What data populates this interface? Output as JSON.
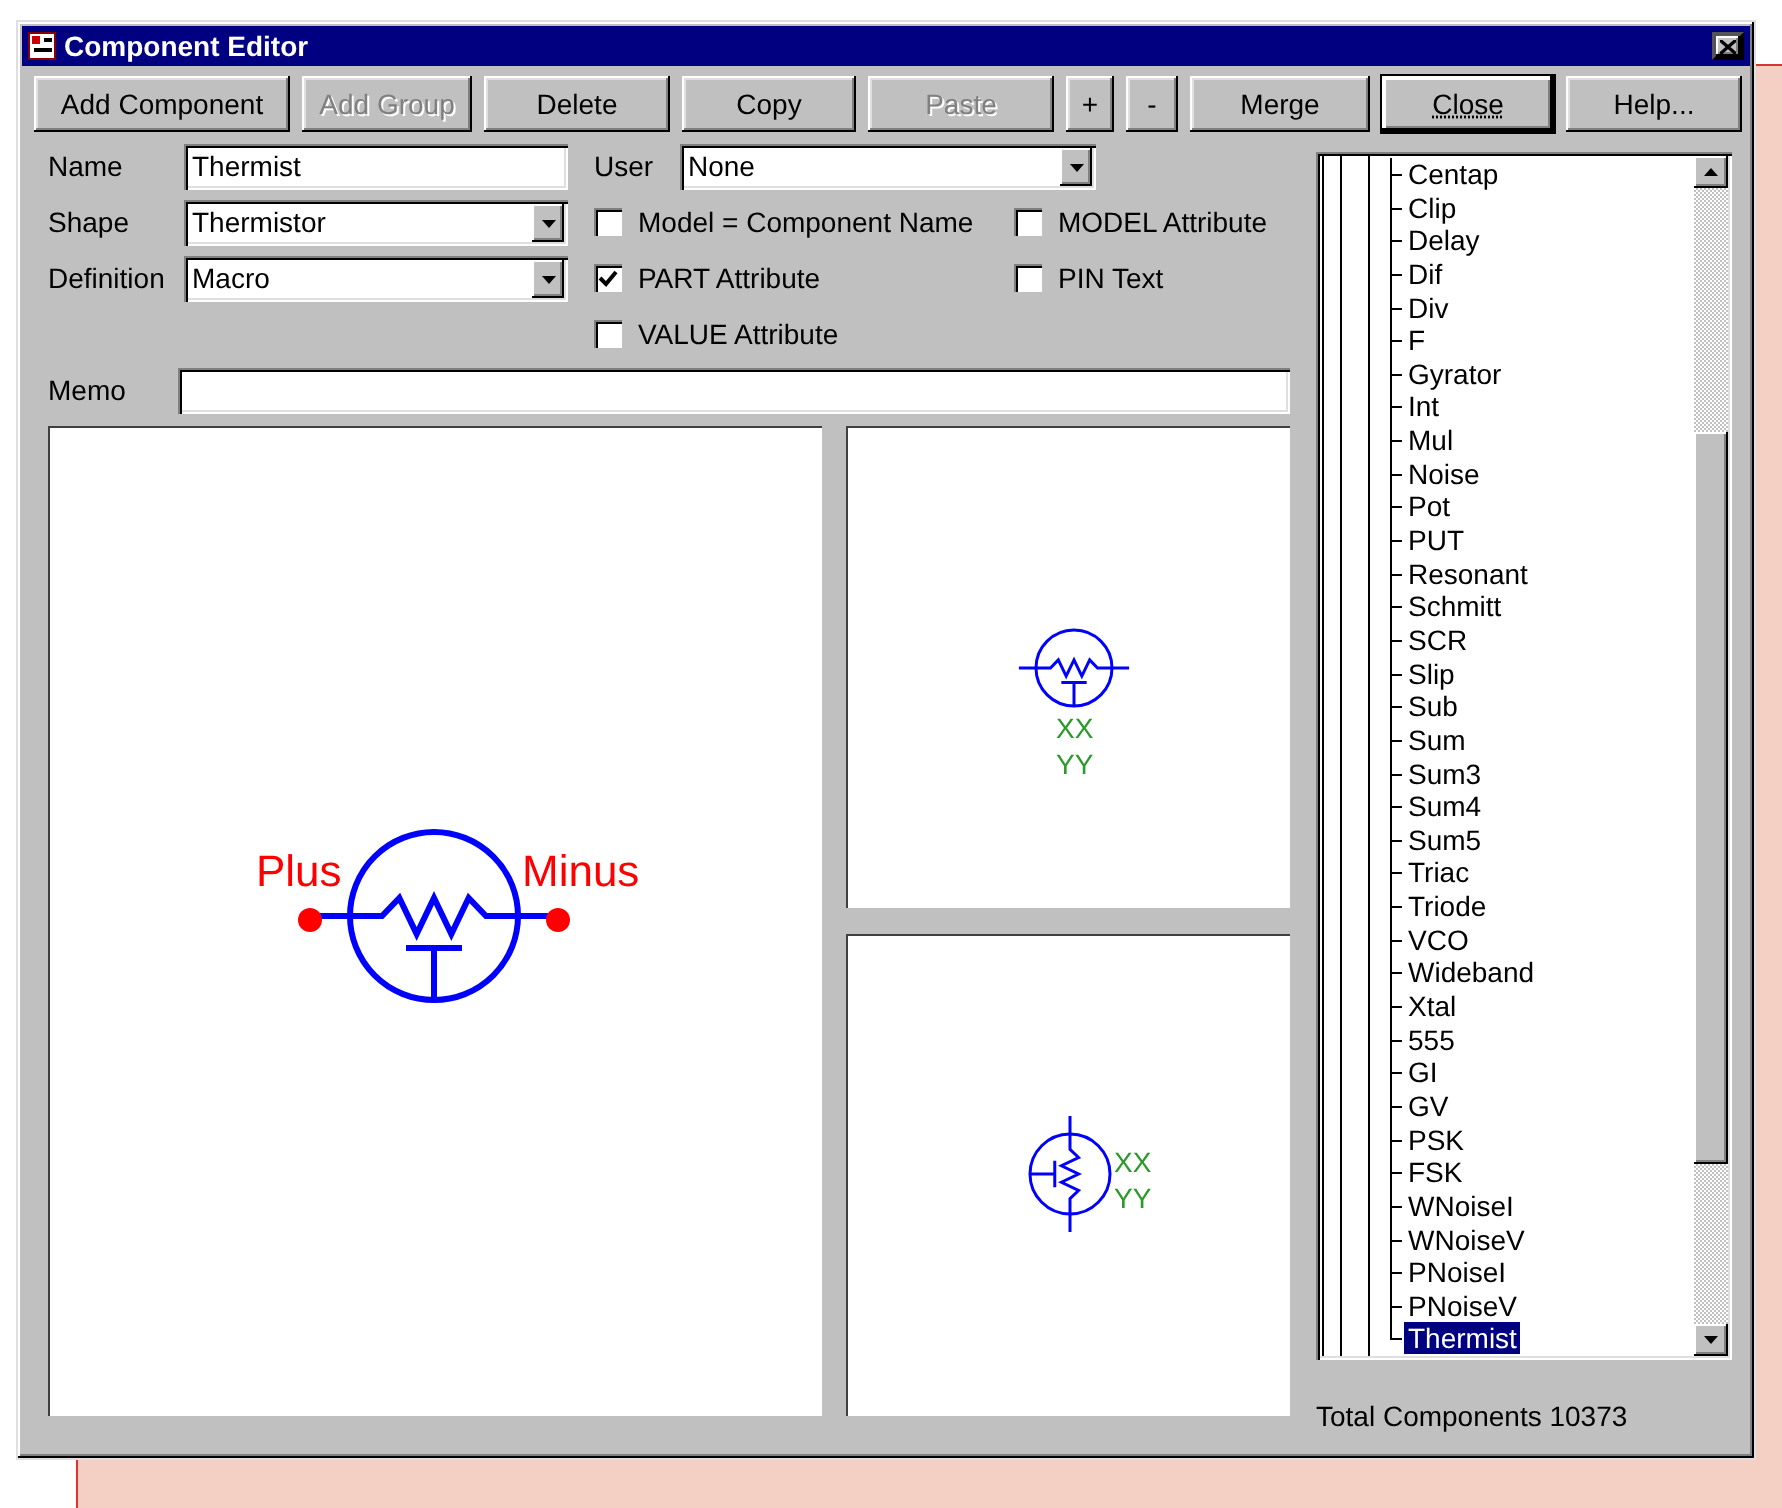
{
  "window": {
    "title": "Component Editor"
  },
  "toolbar": [
    {
      "label": "Add Component",
      "disabled": false,
      "default": false
    },
    {
      "label": "Add Group",
      "disabled": true,
      "default": false
    },
    {
      "label": "Delete",
      "disabled": false,
      "default": false
    },
    {
      "label": "Copy",
      "disabled": false,
      "default": false
    },
    {
      "label": "Paste",
      "disabled": true,
      "default": false
    },
    {
      "label": "+",
      "disabled": false,
      "default": false
    },
    {
      "label": "-",
      "disabled": false,
      "default": false
    },
    {
      "label": "Merge",
      "disabled": false,
      "default": false
    },
    {
      "label": "Close",
      "disabled": false,
      "default": true
    },
    {
      "label": "Help...",
      "disabled": false,
      "default": false
    }
  ],
  "fields": [
    {
      "label": "Name",
      "value": "Thermist",
      "kind": "text"
    },
    {
      "label": "Shape",
      "value": "Thermistor",
      "kind": "dropdown"
    },
    {
      "label": "Definition",
      "value": "Macro",
      "kind": "dropdown"
    }
  ],
  "user": {
    "label": "User",
    "value": "None"
  },
  "checkboxes": [
    {
      "label": "Model = Component Name",
      "checked": false
    },
    {
      "label": "MODEL Attribute",
      "checked": false
    },
    {
      "label": "PART Attribute",
      "checked": true
    },
    {
      "label": "PIN Text",
      "checked": false
    },
    {
      "label": "VALUE Attribute",
      "checked": false
    }
  ],
  "memo": {
    "label": "Memo"
  },
  "main_preview": {
    "pins": [
      "Plus",
      "Minus"
    ]
  },
  "small_previews": [
    {
      "kind": "horizontal",
      "labels": [
        "XX",
        "YY"
      ]
    },
    {
      "kind": "vertical",
      "labels": [
        "XX",
        "YY"
      ]
    }
  ],
  "tree": [
    {
      "label": "Centap",
      "selected": false
    },
    {
      "label": "Clip",
      "selected": false
    },
    {
      "label": "Delay",
      "selected": false
    },
    {
      "label": "Dif",
      "selected": false
    },
    {
      "label": "Div",
      "selected": false
    },
    {
      "label": "F",
      "selected": false
    },
    {
      "label": "Gyrator",
      "selected": false
    },
    {
      "label": "Int",
      "selected": false
    },
    {
      "label": "Mul",
      "selected": false
    },
    {
      "label": "Noise",
      "selected": false
    },
    {
      "label": "Pot",
      "selected": false
    },
    {
      "label": "PUT",
      "selected": false
    },
    {
      "label": "Resonant",
      "selected": false
    },
    {
      "label": "Schmitt",
      "selected": false
    },
    {
      "label": "SCR",
      "selected": false
    },
    {
      "label": "Slip",
      "selected": false
    },
    {
      "label": "Sub",
      "selected": false
    },
    {
      "label": "Sum",
      "selected": false
    },
    {
      "label": "Sum3",
      "selected": false
    },
    {
      "label": "Sum4",
      "selected": false
    },
    {
      "label": "Sum5",
      "selected": false
    },
    {
      "label": "Triac",
      "selected": false
    },
    {
      "label": "Triode",
      "selected": false
    },
    {
      "label": "VCO",
      "selected": false
    },
    {
      "label": "Wideband",
      "selected": false
    },
    {
      "label": "Xtal",
      "selected": false
    },
    {
      "label": "555",
      "selected": false
    },
    {
      "label": "GI",
      "selected": false
    },
    {
      "label": "GV",
      "selected": false
    },
    {
      "label": "PSK",
      "selected": false
    },
    {
      "label": "FSK",
      "selected": false
    },
    {
      "label": "WNoiseI",
      "selected": false
    },
    {
      "label": "WNoiseV",
      "selected": false
    },
    {
      "label": "PNoiseI",
      "selected": false
    },
    {
      "label": "PNoiseV",
      "selected": false
    },
    {
      "label": "Thermist",
      "selected": true
    }
  ],
  "status": "Total Components 10373"
}
